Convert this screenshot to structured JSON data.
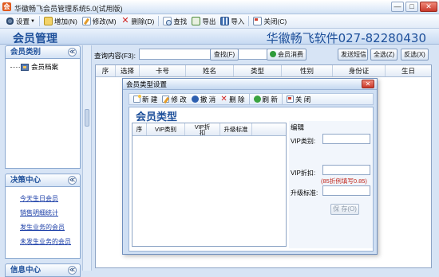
{
  "window": {
    "title": "华徽畅飞会员管理系统5.0(试用版)",
    "controls": [
      "—",
      "□",
      "✕"
    ]
  },
  "toolbar": {
    "items": [
      {
        "label": "设置",
        "icon": "settings-icon"
      },
      {
        "label": "增加(N)",
        "icon": "add-icon"
      },
      {
        "label": "修改(M)",
        "icon": "edit-icon"
      },
      {
        "label": "删除(D)",
        "icon": "delete-icon"
      },
      {
        "label": "查找",
        "icon": "find-icon"
      },
      {
        "label": "导出",
        "icon": "export-icon"
      },
      {
        "label": "导入",
        "icon": "import-icon"
      },
      {
        "label": "关闭(C)",
        "icon": "close-doc-icon"
      }
    ]
  },
  "header": {
    "module_title": "会员管理",
    "company": "华徽畅飞软件027-82280430"
  },
  "sidebar": {
    "panel1_title": "会员类别",
    "tree_item": "会员档案",
    "panel2_title": "决策中心",
    "links": [
      "今天生日会员",
      "销售明细统计",
      "发生业务的会员",
      "未发生业务的会员"
    ],
    "panel3_title": "信息中心",
    "collapse_glyph": "≪"
  },
  "search": {
    "label": "查询内容(F3):",
    "value": "",
    "find_button": "查找(F)",
    "consume_button": "会员消费",
    "sms_button": "发送短信",
    "select_all_button": "全选(Z)",
    "invert_button": "反选(X)"
  },
  "grid": {
    "columns": [
      "序",
      "选择",
      "卡号",
      "姓名",
      "类型",
      "性别",
      "身份证",
      "生日"
    ]
  },
  "dialog": {
    "title": "会员类型设置",
    "close_glyph": "✕",
    "toolbar": [
      "新 建",
      "修 改",
      "撤 消",
      "删 除",
      "刷 新",
      "关 闭"
    ],
    "heading": "会员类型",
    "columns": [
      "序",
      "VIP类别",
      "VIP折扣",
      "升级标准"
    ],
    "edit": {
      "title": "编辑",
      "vip_category_label": "VIP类别:",
      "vip_category_value": "",
      "vip_discount_label": "VIP折扣:",
      "vip_discount_value": "",
      "hint": "(85折例填写0.85)",
      "upgrade_label": "升级标准:",
      "upgrade_value": "",
      "save_button": "保 存(O)"
    }
  },
  "colors": {
    "accent": "#1d4f9a",
    "link": "#1c3fa8",
    "hint": "#c0261c",
    "background": "#d7e4f5"
  }
}
